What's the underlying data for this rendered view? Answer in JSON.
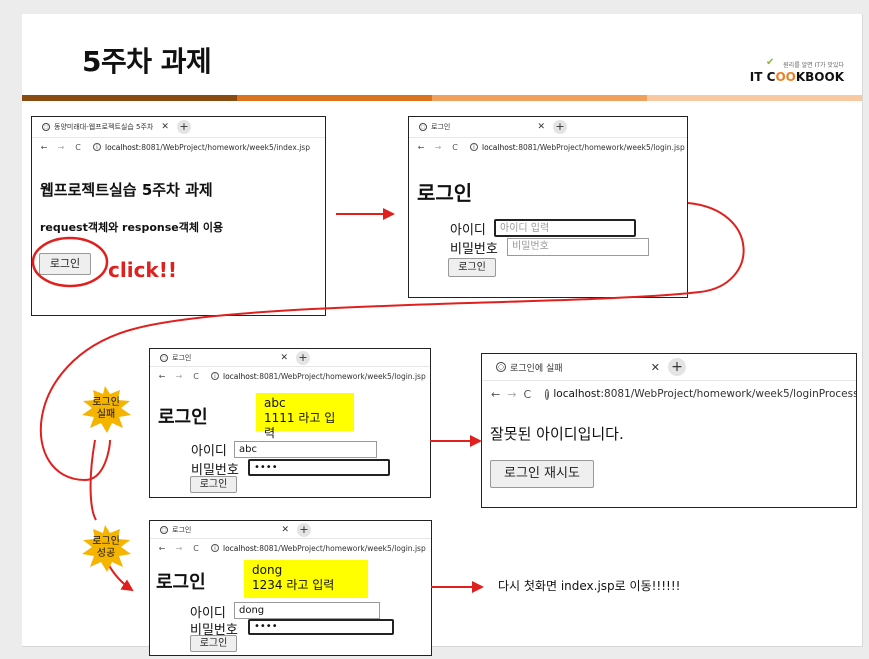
{
  "slide": {
    "title": "5주차 과제",
    "logo": {
      "tagline": "원리를 알면 IT가 맛있다",
      "brand_prefix": "IT C",
      "brand_oo": "OO",
      "brand_suffix": "KBOOK"
    },
    "bar_colors": [
      "#8a4b12",
      "#d9731f",
      "#f0a05a",
      "#f8c9a0"
    ]
  },
  "window1": {
    "tab_title": "동양미래대-웹프로젝트실습 5주차",
    "url_host": "localhost",
    "url_rest": ":8081/WebProject/homework/week5/index.jsp",
    "heading": "웹프로젝트실습 5주차 과제",
    "subheading": "request객체와 response객체 이용",
    "login_button": "로그인"
  },
  "click_label": "click!!",
  "window2": {
    "tab_title": "로그인",
    "url_host": "localhost",
    "url_rest": ":8081/WebProject/homework/week5/login.jsp",
    "heading": "로그인",
    "id_label": "아이디",
    "id_placeholder": "아이디 입력",
    "pw_label": "비밀번호",
    "pw_placeholder": "비밀번호",
    "button": "로그인"
  },
  "window3": {
    "tab_title": "로그인",
    "url_host": "localhost",
    "url_rest": ":8081/WebProject/homework/week5/login.jsp",
    "heading": "로그인",
    "note_line1": "abc",
    "note_line2": "1111 라고 입력",
    "id_label": "아이디",
    "id_value": "abc",
    "pw_label": "비밀번호",
    "pw_value": "••••",
    "button": "로그인"
  },
  "window4": {
    "tab_title": "로그인에 실패",
    "url_host": "localhost",
    "url_rest": ":8081/WebProject/homework/week5/loginProcess.jsp",
    "message": "잘못된 아이디입니다.",
    "retry_button": "로그인 재시도"
  },
  "window5": {
    "tab_title": "로그인",
    "url_host": "localhost",
    "url_rest": ":8081/WebProject/homework/week5/login.jsp",
    "heading": "로그인",
    "note_line1": "dong",
    "note_line2": "1234 라고 입력",
    "id_label": "아이디",
    "id_value": "dong",
    "pw_label": "비밀번호",
    "pw_value": "••••",
    "button": "로그인"
  },
  "badges": {
    "fail_line1": "로그인",
    "fail_line2": "실패",
    "success_line1": "로그인",
    "success_line2": "성공"
  },
  "final_note": "다시 첫화면 index.jsp로 이동!!!!!!",
  "colors": {
    "arrow": "#e0201e",
    "highlight": "#ffff00",
    "burst": "#f5b400"
  }
}
